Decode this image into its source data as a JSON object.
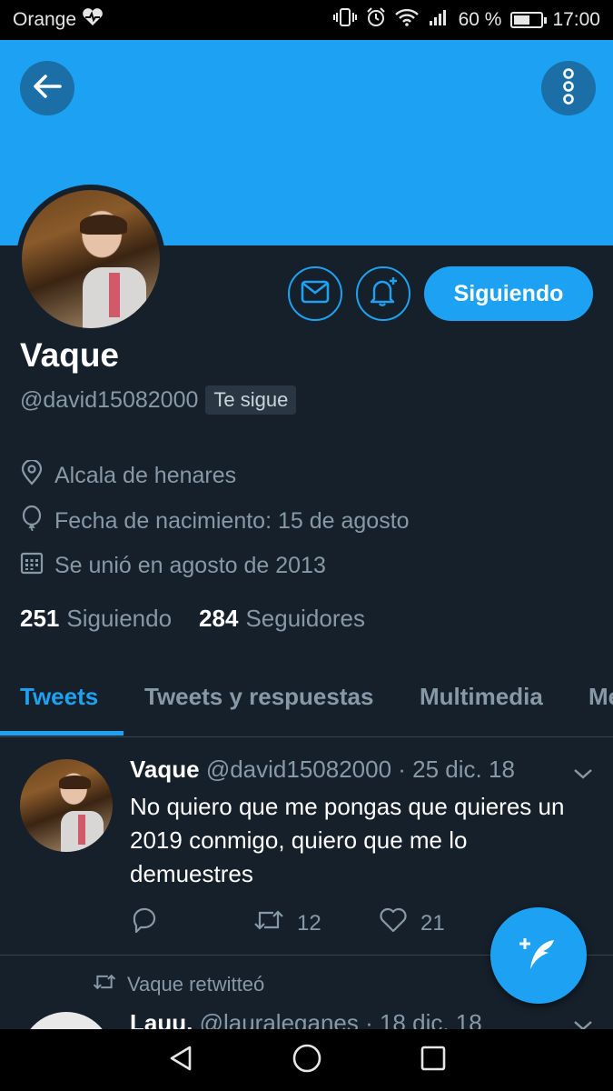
{
  "status_bar": {
    "carrier": "Orange",
    "battery_percent": "60 %",
    "battery_level": 0.6,
    "time": "17:00"
  },
  "header": {
    "back_icon": "arrow-left-icon",
    "more_icon": "more-vertical-icon",
    "banner_color": "#1da1f2"
  },
  "profile": {
    "name": "Vaque",
    "handle": "@david15082000",
    "follows_you_badge": "Te sigue",
    "follow_button_label": "Siguiendo",
    "location": "Alcala de henares",
    "birthday": "Fecha de nacimiento: 15 de agosto",
    "joined": "Se unió en agosto de 2013",
    "following_count": "251",
    "following_label": "Siguiendo",
    "followers_count": "284",
    "followers_label": "Seguidores"
  },
  "tabs": [
    {
      "label": "Tweets",
      "active": true
    },
    {
      "label": "Tweets y respuestas",
      "active": false
    },
    {
      "label": "Multimedia",
      "active": false
    },
    {
      "label": "Me",
      "active": false
    }
  ],
  "tweets": [
    {
      "name": "Vaque",
      "handle_date": "@david15082000 · 25 dic. 18",
      "text": "No quiero que me pongas que quieres un 2019 conmigo, quiero que me lo demuestres",
      "retweets": "12",
      "likes": "21"
    }
  ],
  "retweet_notice": "Vaque retwitteó",
  "tweet2": {
    "name": "Lauu.",
    "handle_date": "@lauraleganes · 18 dic. 18"
  },
  "colors": {
    "accent": "#1da1f2",
    "background": "#15202b",
    "secondary_text": "#8899a6"
  }
}
